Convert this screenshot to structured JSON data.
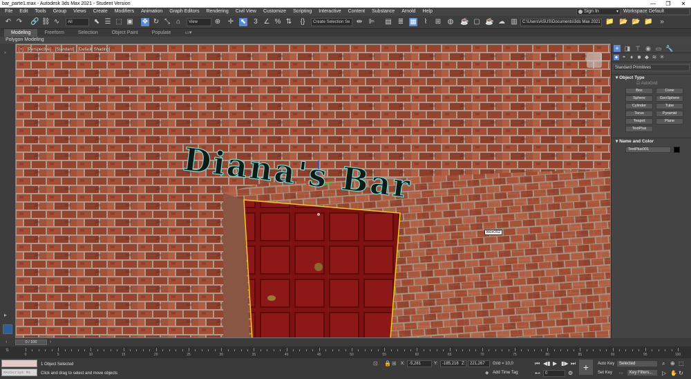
{
  "window": {
    "title": "bar_parte1.max - Autodesk 3ds Max 2021 - Student Version",
    "minimize": "—",
    "maximize": "❐",
    "close": "✕"
  },
  "menu": {
    "items": [
      "File",
      "Edit",
      "Tools",
      "Group",
      "Views",
      "Create",
      "Modifiers",
      "Animation",
      "Graph Editors",
      "Rendering",
      "Civil View",
      "Customize",
      "Scripting",
      "Interactive",
      "Content",
      "Substance",
      "Arnold",
      "Help"
    ],
    "signin": "Sign In",
    "workspaces_label": "Workspaces:",
    "workspaces_value": "Default"
  },
  "toolbar": {
    "filter_select": "All",
    "refcoord_select": "View",
    "selection_set": "Create Selection Se",
    "project_path": "C:\\Users\\ASUS\\Documents\\3ds Max 2021"
  },
  "ribbon": {
    "tabs": [
      "Modeling",
      "Freeform",
      "Selection",
      "Object Paint",
      "Populate"
    ],
    "subpanel": "Polygon Modeling"
  },
  "viewport": {
    "labels": [
      "[+]",
      "[Perspective]",
      "[Standard]",
      "[Default Shading]"
    ],
    "scene_text": "Diana's Bar",
    "tooltip": "Box002"
  },
  "command_panel": {
    "category": "Standard Primitives",
    "object_type_header": "Object Type",
    "autogrid": "AutoGrid",
    "buttons": [
      "Box",
      "Cone",
      "Sphere",
      "GeoSphere",
      "Cylinder",
      "Tube",
      "Torus",
      "Pyramid",
      "Teapot",
      "Plane",
      "TextPlus"
    ],
    "name_color_header": "Name and Color",
    "object_name": "TextPlus001",
    "object_color": "#000000"
  },
  "timeline": {
    "slider": "0 / 100",
    "ticks": [
      0,
      5,
      10,
      15,
      20,
      25,
      30,
      35,
      40,
      45,
      50,
      55,
      60,
      65,
      70,
      75,
      80,
      85,
      90,
      95,
      100
    ]
  },
  "status": {
    "maxscript": "MAXScript Mi",
    "selected": "1 Object Selected",
    "prompt": "Click and drag to select and move objects",
    "x_label": "X:",
    "x_value": "-5,281",
    "y_label": "Y:",
    "y_value": "-185,216",
    "z_label": "Z:",
    "z_value": "221,267",
    "grid": "Grid = 10,0",
    "add_time_tag": "Add Time Tag",
    "frame": "0",
    "auto_key": "Auto Key",
    "set_key": "Set Key",
    "selected_dropdown": "Selected",
    "key_filters": "Key Filters..."
  }
}
